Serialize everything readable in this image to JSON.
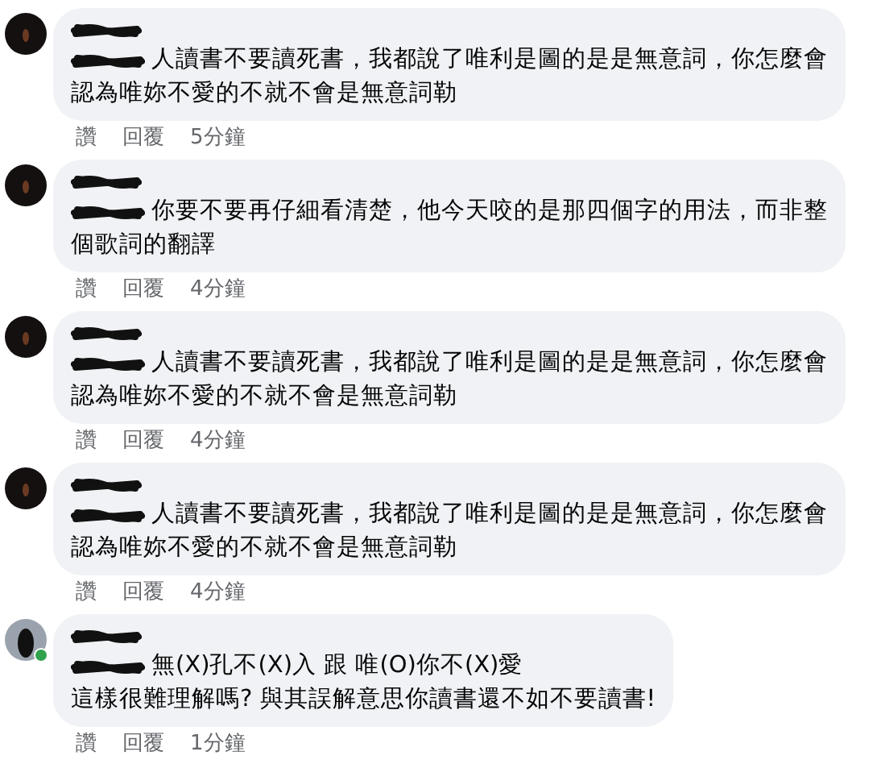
{
  "comments": [
    {
      "lines": [
        "人讀書不要讀死書，我都說了唯利是圖的是是無意詞，你怎麼會",
        "認為唯妳不愛的不就不會是無意詞勒"
      ],
      "actions": [
        "讚",
        "回覆"
      ],
      "time": "5分鐘",
      "online": false
    },
    {
      "lines": [
        "你要不要再仔細看清楚，他今天咬的是那四個字的用法，而非整",
        "個歌詞的翻譯"
      ],
      "actions": [
        "讚",
        "回覆"
      ],
      "time": "4分鐘",
      "online": false
    },
    {
      "lines": [
        "人讀書不要讀死書，我都說了唯利是圖的是是無意詞，你怎麼會",
        "認為唯妳不愛的不就不會是無意詞勒"
      ],
      "actions": [
        "讚",
        "回覆"
      ],
      "time": "4分鐘",
      "online": false
    },
    {
      "lines": [
        "人讀書不要讀死書，我都說了唯利是圖的是是無意詞，你怎麼會",
        "認為唯妳不愛的不就不會是無意詞勒"
      ],
      "actions": [
        "讚",
        "回覆"
      ],
      "time": "4分鐘",
      "online": false
    },
    {
      "lines": [
        "無(X)孔不(X)入 跟 唯(O)你不(X)愛",
        "這樣很難理解嗎? 與其誤解意思你讀書還不如不要讀書!"
      ],
      "actions": [
        "讚",
        "回覆"
      ],
      "time": "1分鐘",
      "online": true
    }
  ]
}
